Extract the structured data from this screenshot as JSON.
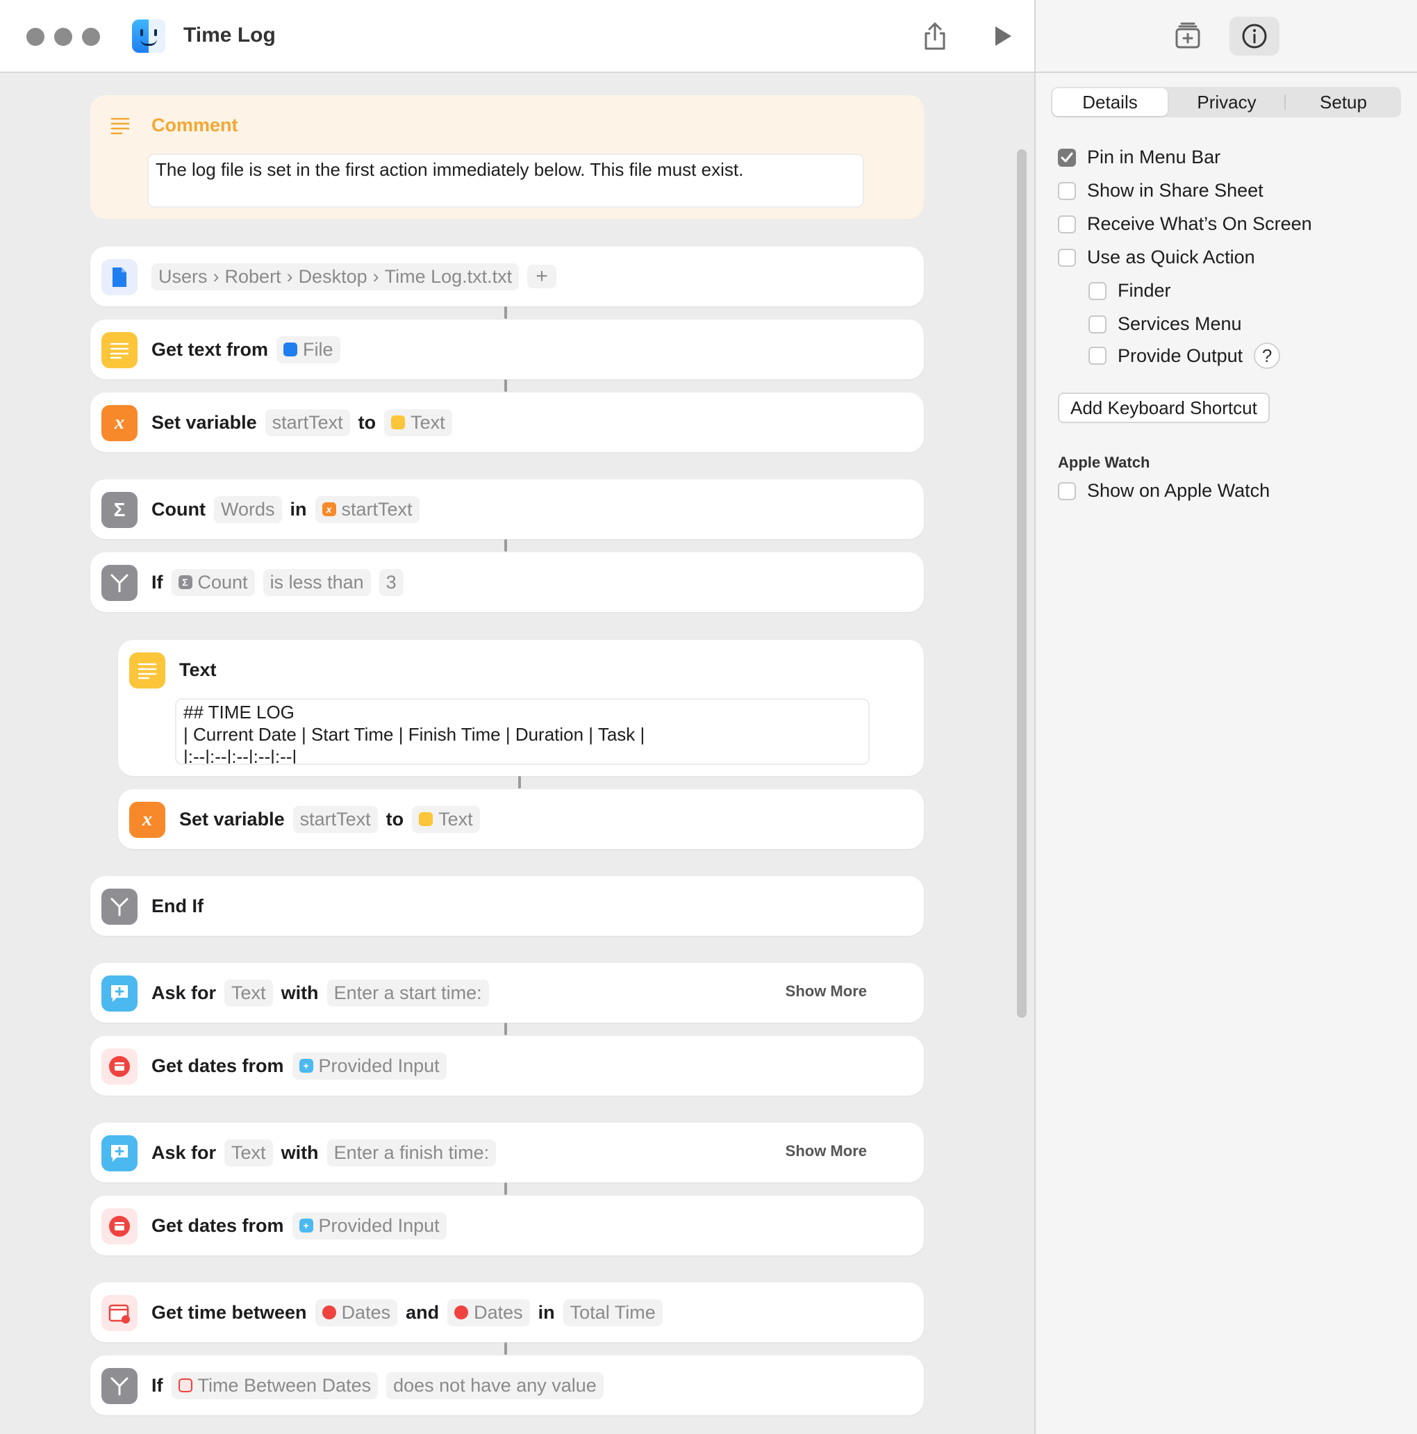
{
  "window": {
    "title": "Time Log"
  },
  "comment": {
    "title": "Comment",
    "text": "The log file is set in the first action immediately below. This file must exist."
  },
  "actions": {
    "file_path": {
      "segments": [
        "Users",
        "Robert",
        "Desktop",
        "Time Log.txt.txt"
      ],
      "add": "+"
    },
    "get_text": {
      "label": "Get text from",
      "source": "File"
    },
    "set_var_1": {
      "label": "Set variable",
      "name": "startText",
      "to": "to",
      "value": "Text"
    },
    "count": {
      "label": "Count",
      "unit": "Words",
      "in": "in",
      "var": "startText"
    },
    "if_1": {
      "label": "If",
      "subject": "Count",
      "op": "is less than",
      "value": "3"
    },
    "text_block": {
      "label": "Text",
      "content": "## TIME LOG\n| Current Date | Start Time | Finish Time | Duration | Task |\n|:--|:--|:--|:--|:--|"
    },
    "set_var_2": {
      "label": "Set variable",
      "name": "startText",
      "to": "to",
      "value": "Text"
    },
    "end_if": {
      "label": "End If"
    },
    "ask_1": {
      "label": "Ask for",
      "type": "Text",
      "with": "with",
      "prompt": "Enter a start time:",
      "show_more": "Show More"
    },
    "dates_1": {
      "label": "Get dates from",
      "source": "Provided Input"
    },
    "ask_2": {
      "label": "Ask for",
      "type": "Text",
      "with": "with",
      "prompt": "Enter a finish time:",
      "show_more": "Show More"
    },
    "dates_2": {
      "label": "Get dates from",
      "source": "Provided Input"
    },
    "time_between": {
      "label": "Get time between",
      "a": "Dates",
      "and": "and",
      "b": "Dates",
      "in": "in",
      "unit": "Total Time"
    },
    "if_2": {
      "label": "If",
      "subject": "Time Between Dates",
      "op": "does not have any value"
    }
  },
  "side": {
    "tabs": [
      "Details",
      "Privacy",
      "Setup"
    ],
    "active_tab": "Details",
    "options": [
      {
        "label": "Pin in Menu Bar",
        "checked": true
      },
      {
        "label": "Show in Share Sheet",
        "checked": false
      },
      {
        "label": "Receive What’s On Screen",
        "checked": false
      },
      {
        "label": "Use as Quick Action",
        "checked": false
      },
      {
        "label": "Finder",
        "checked": false
      },
      {
        "label": "Services Menu",
        "checked": false
      },
      {
        "label": "Provide Output",
        "checked": false
      }
    ],
    "help": "?",
    "shortcut_button": "Add Keyboard Shortcut",
    "watch_heading": "Apple Watch",
    "watch_option": {
      "label": "Show on Apple Watch",
      "checked": false
    }
  },
  "colors": {
    "orange": "#f7892a",
    "yellow": "#fcc53a",
    "blue": "#1f7ef0",
    "gray": "#8e8e93",
    "red": "#f0433f",
    "cyan": "#4cb8f0",
    "comment": "#f3a734"
  }
}
